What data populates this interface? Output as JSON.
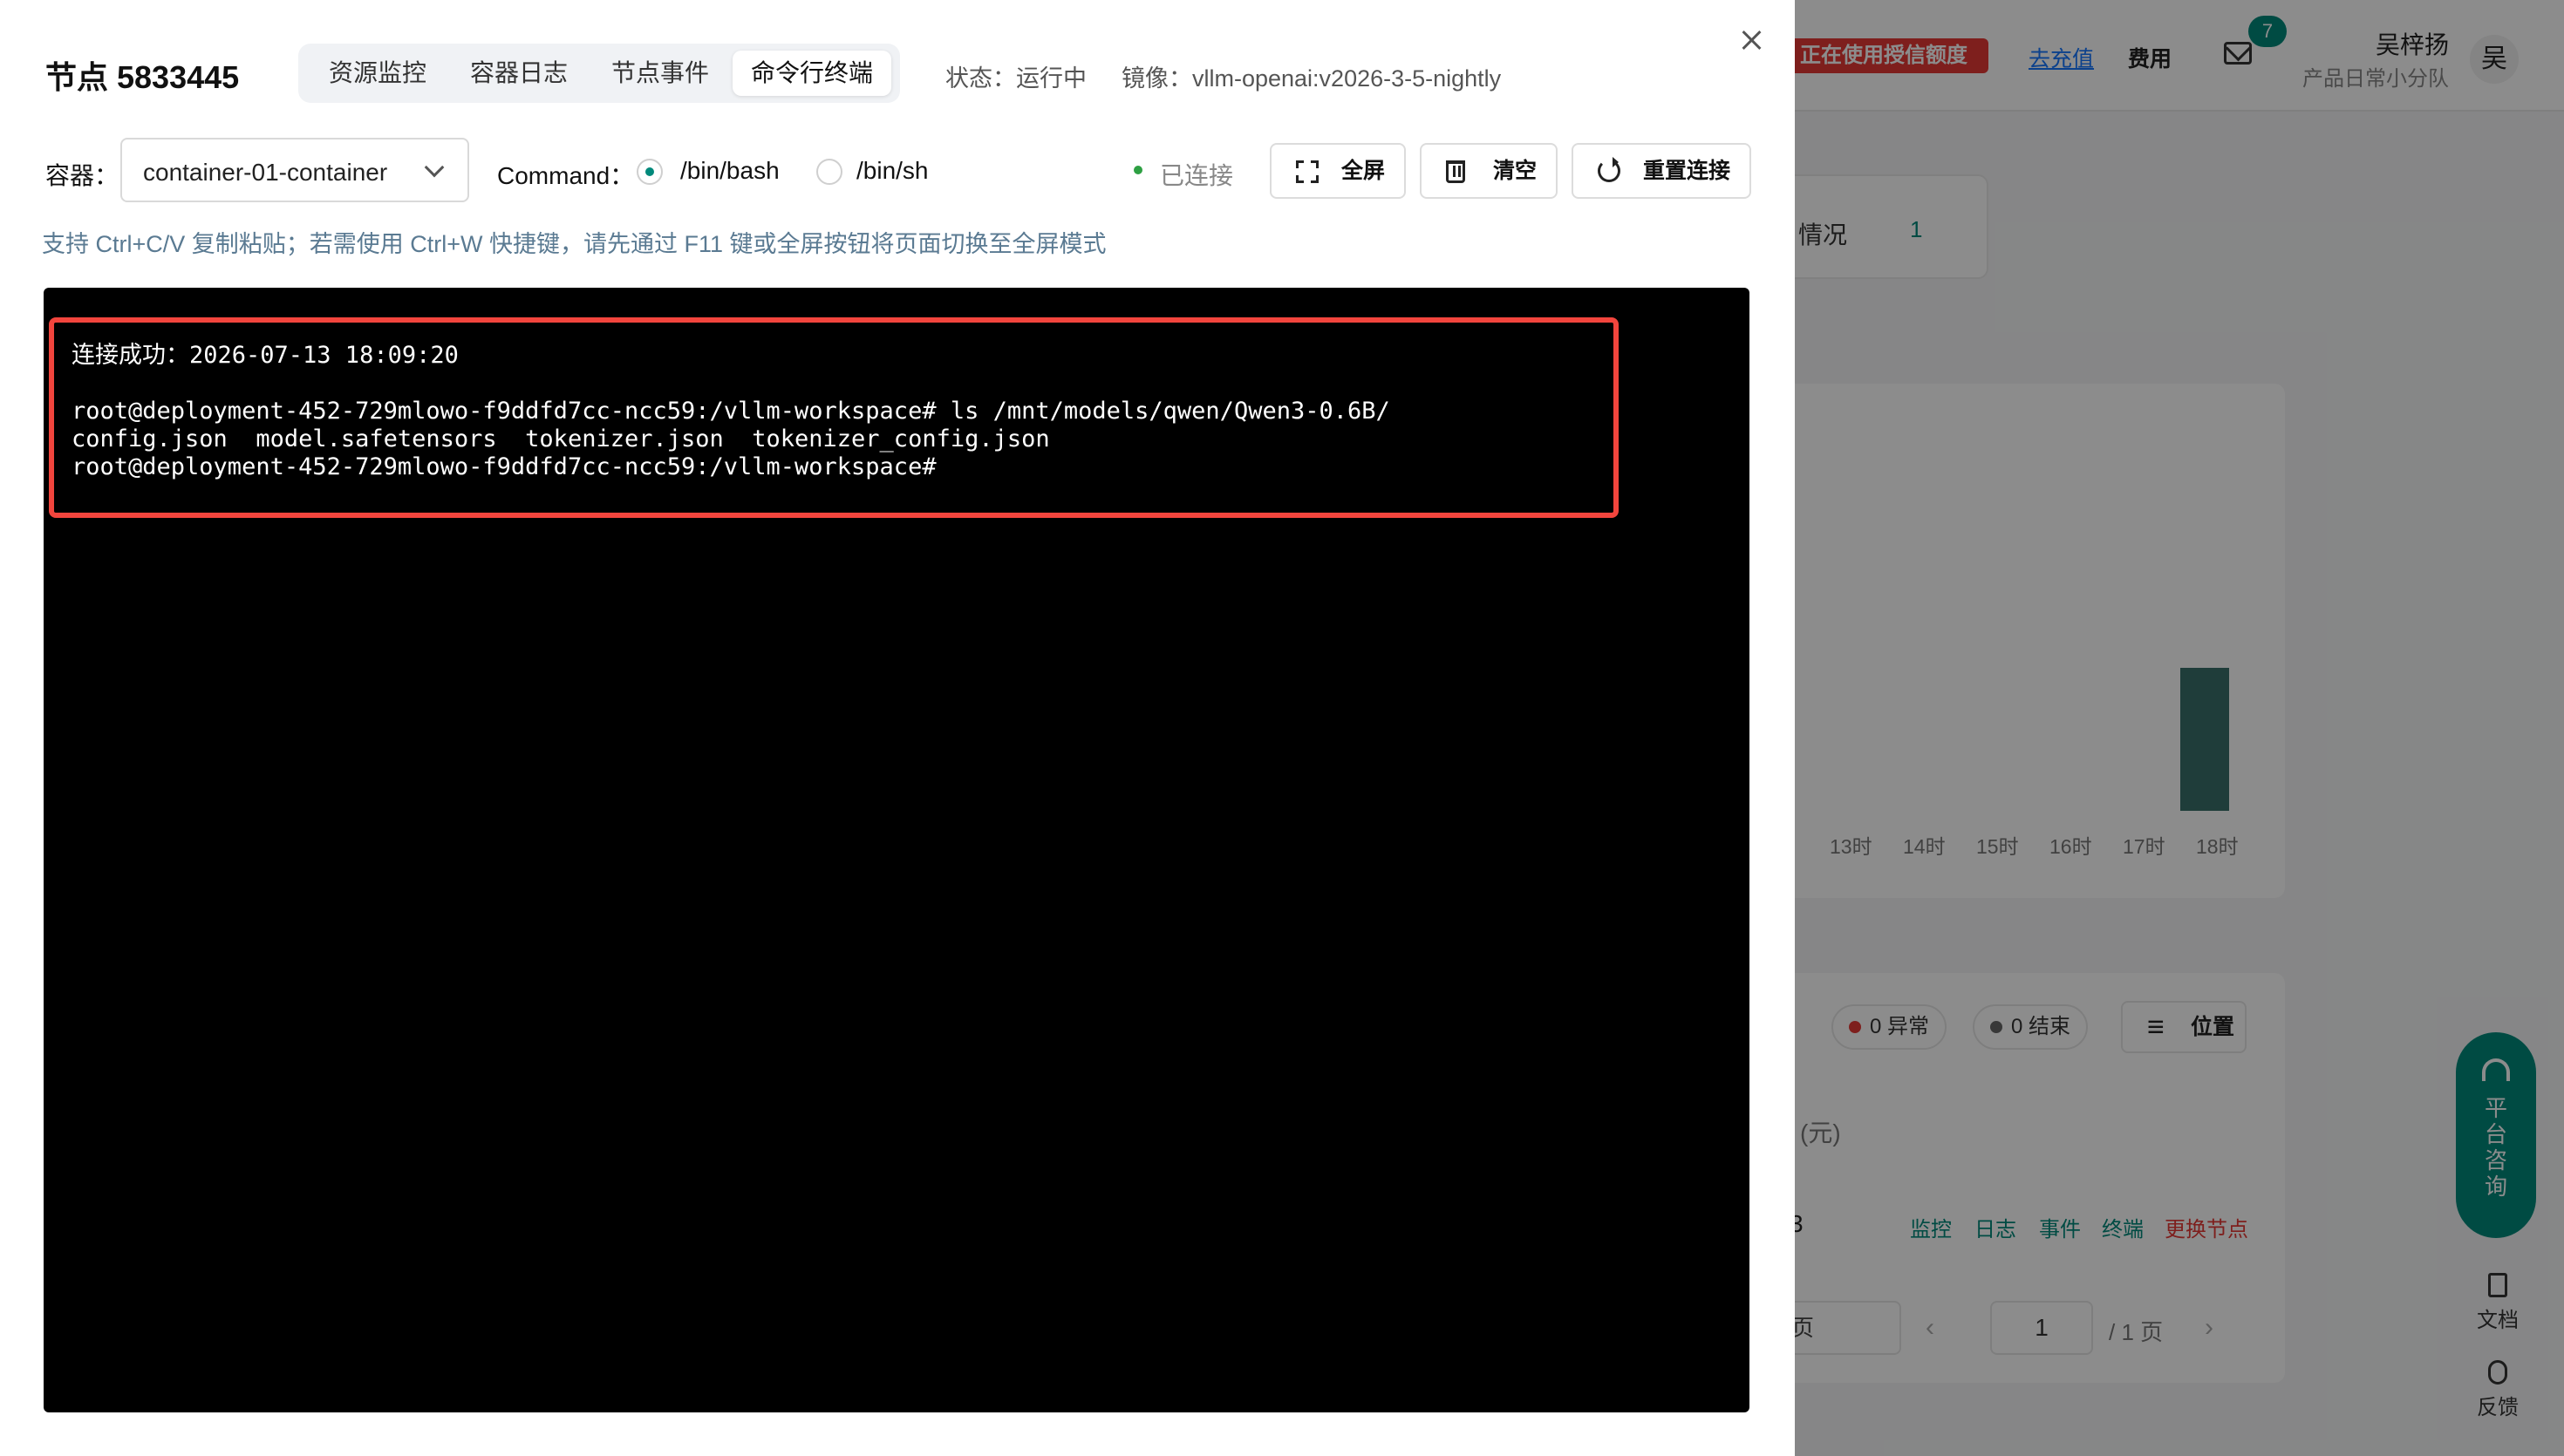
{
  "background": {
    "quota_badge": "正在使用授信额度",
    "recharge_link": "去充值",
    "cost_link": "费用",
    "mail_count": "7",
    "user_name": "吴梓扬",
    "user_team": "产品日常小分队",
    "avatar": "吴",
    "tab_card_label": "情况",
    "tab_card_count": "1",
    "chart_ticks": [
      "13时",
      "14时",
      "15时",
      "16时",
      "17时",
      "18时"
    ],
    "chips": [
      {
        "label": "0 异常",
        "color": "#e53935"
      },
      {
        "label": "0 结束",
        "color": "#666666"
      }
    ],
    "filter_button": "位置",
    "unit_text": "(元)",
    "row_number": "3",
    "row_actions": [
      "监控",
      "日志",
      "事件",
      "终端",
      "更换节点"
    ],
    "pager_size": "页",
    "pager_current": "1",
    "pager_total": "/ 1 页",
    "consult_text": "平台咨询",
    "side_docs": "文档",
    "side_feedback": "反馈"
  },
  "drawer": {
    "title": "节点 5833445",
    "tabs": [
      {
        "label": "资源监控",
        "active": false
      },
      {
        "label": "容器日志",
        "active": false
      },
      {
        "label": "节点事件",
        "active": false
      },
      {
        "label": "命令行终端",
        "active": true
      }
    ],
    "status": "状态：运行中",
    "image": "镜像：vllm-openai:v2026-3-5-nightly",
    "container_label": "容器：",
    "container_value": "container-01-container",
    "command_label": "Command：",
    "shell_options": [
      {
        "label": "/bin/bash",
        "checked": true
      },
      {
        "label": "/bin/sh",
        "checked": false
      }
    ],
    "connection_status": "已连接",
    "buttons": {
      "fullscreen": "全屏",
      "clear": "清空",
      "reconnect": "重置连接"
    },
    "hint": "支持 Ctrl+C/V 复制粘贴；若需使用 Ctrl+W 快捷键，请先通过 F11 键或全屏按钮将页面切换至全屏模式"
  },
  "terminal": {
    "lines": [
      "连接成功：2026-07-13 18:09:20",
      "",
      "root@deployment-452-729mlowo-f9ddfd7cc-ncc59:/vllm-workspace# ls /mnt/models/qwen/Qwen3-0.6B/",
      "config.json  model.safetensors  tokenizer.json  tokenizer_config.json",
      "root@deployment-452-729mlowo-f9ddfd7cc-ncc59:/vllm-workspace#"
    ],
    "highlight_color": "#f2453d"
  }
}
